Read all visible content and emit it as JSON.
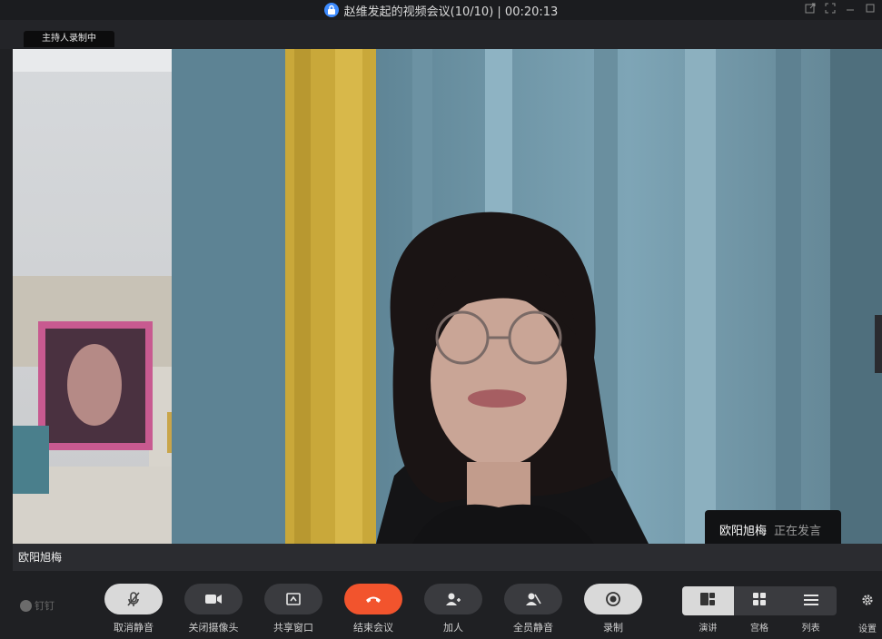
{
  "window": {
    "title": "赵维发起的视频会议(10/10) | 00:20:13"
  },
  "recording_badge": "主持人录制中",
  "video": {
    "participant_name": "欧阳旭梅",
    "speaker_card": {
      "name": "欧阳旭梅",
      "status": "正在发言"
    }
  },
  "toolbar": {
    "brand": "钉钉",
    "buttons": [
      {
        "label": "取消静音",
        "icon": "microphone-muted-icon"
      },
      {
        "label": "关闭摄像头",
        "icon": "camera-icon"
      },
      {
        "label": "共享窗口",
        "icon": "share-screen-icon"
      },
      {
        "label": "结束会议",
        "icon": "hang-up-icon"
      },
      {
        "label": "加人",
        "icon": "add-person-icon"
      },
      {
        "label": "全员静音",
        "icon": "mute-all-icon"
      },
      {
        "label": "录制",
        "icon": "record-icon"
      }
    ],
    "layouts": [
      {
        "label": "演讲",
        "icon": "speaker-layout-icon",
        "active": true
      },
      {
        "label": "宫格",
        "icon": "grid-layout-icon",
        "active": false
      },
      {
        "label": "列表",
        "icon": "list-layout-icon",
        "active": false
      }
    ],
    "settings_label": "设置"
  },
  "colors": {
    "end_meeting": "#f2542d",
    "lock_badge": "#3d8bff",
    "background": "#1f2023"
  }
}
